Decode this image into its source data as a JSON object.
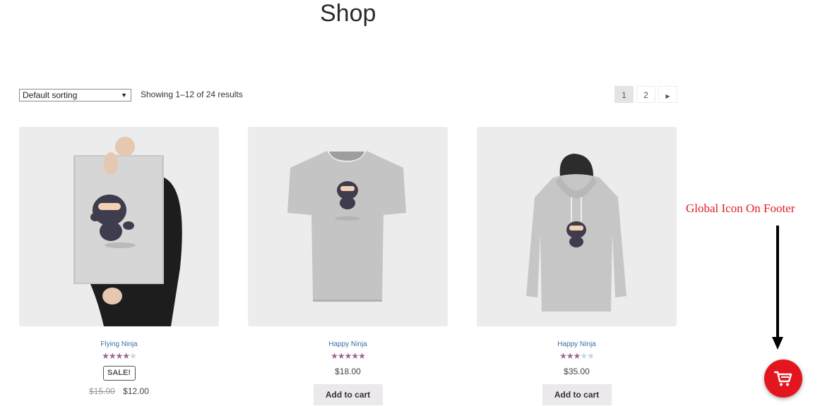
{
  "page": {
    "title": "Shop"
  },
  "toolbar": {
    "sort_selected": "Default sorting",
    "result_count": "Showing 1–12 of 24 results"
  },
  "pagination": {
    "pages": [
      "1",
      "2"
    ],
    "current": "1",
    "next_icon": "chevron-right-icon"
  },
  "products": [
    {
      "name": "Flying Ninja",
      "rating_of_5": 4,
      "sale_badge": "SALE!",
      "old_price": "$15.00",
      "price": "$12.00",
      "image": "poster"
    },
    {
      "name": "Happy Ninja",
      "rating_of_5": 5,
      "price": "$18.00",
      "button": "Add to cart",
      "image": "tshirt"
    },
    {
      "name": "Happy Ninja",
      "rating_of_5": 3,
      "price": "$35.00",
      "button": "Add to cart",
      "image": "hoodie"
    }
  ],
  "annotation": {
    "text": "Global Icon On Footer"
  },
  "cart_button": {
    "icon": "cart-icon",
    "color": "#e3161f"
  },
  "colors": {
    "link": "#3d6fa8",
    "star": "#9b6593",
    "accent": "#e3161f"
  }
}
